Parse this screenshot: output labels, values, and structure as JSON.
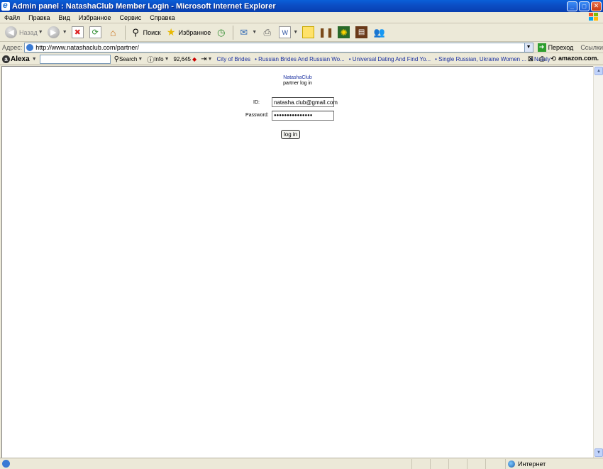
{
  "window": {
    "title": "Admin panel : NatashaClub Member Login - Microsoft Internet Explorer"
  },
  "menu": [
    "Файл",
    "Правка",
    "Вид",
    "Избранное",
    "Сервис",
    "Справка"
  ],
  "toolbar": {
    "back_label": "Назад",
    "search_label": "Поиск",
    "favorites_label": "Избранное"
  },
  "address": {
    "label": "Адрес:",
    "url": "http://www.natashaclub.com/partner/",
    "go_label": "Переход",
    "links_label": "Ссылки"
  },
  "alexa": {
    "logo": "Alexa",
    "search_label": "Search",
    "info_label": "Info",
    "rank": "92,645",
    "links": [
      "City of Brides",
      "• Russian Brides And Russian Wo...",
      "• Universal Dating And Find Yo...",
      "• Single Russian, Ukraine Women ...",
      "• Nataly"
    ],
    "amazon": "amazon.com."
  },
  "page": {
    "brand": "NatashaClub",
    "subtitle": "partner log in",
    "id_label": "ID:",
    "id_value": "natasha.club@gmail.com",
    "password_label": "Password:",
    "password_value": "●●●●●●●●●●●●●●●",
    "login_button": "log in"
  },
  "status": {
    "zone": "Интернет"
  }
}
